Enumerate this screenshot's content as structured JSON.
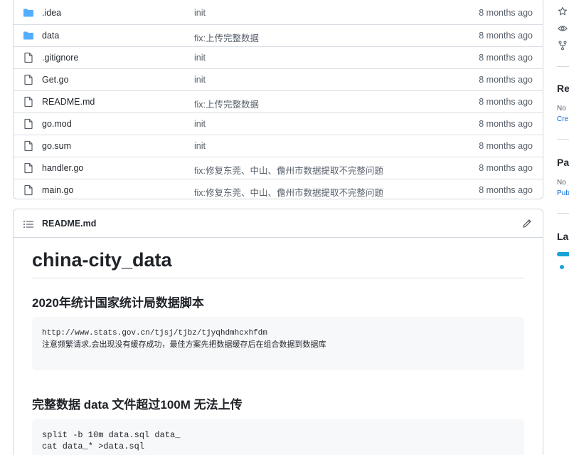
{
  "files": [
    {
      "type": "folder",
      "name": ".idea",
      "message": "init",
      "age": "8 months ago"
    },
    {
      "type": "folder",
      "name": "data",
      "message": "fix:上传完整数据",
      "age": "8 months ago"
    },
    {
      "type": "file",
      "name": ".gitignore",
      "message": "init",
      "age": "8 months ago"
    },
    {
      "type": "file",
      "name": "Get.go",
      "message": "init",
      "age": "8 months ago"
    },
    {
      "type": "file",
      "name": "README.md",
      "message": "fix:上传完整数据",
      "age": "8 months ago"
    },
    {
      "type": "file",
      "name": "go.mod",
      "message": "init",
      "age": "8 months ago"
    },
    {
      "type": "file",
      "name": "go.sum",
      "message": "init",
      "age": "8 months ago"
    },
    {
      "type": "file",
      "name": "handler.go",
      "message": "fix:修复东莞、中山、儋州市数据提取不完整问题",
      "age": "8 months ago"
    },
    {
      "type": "file",
      "name": "main.go",
      "message": "fix:修复东莞、中山、儋州市数据提取不完整问题",
      "age": "8 months ago"
    }
  ],
  "readme": {
    "title": "README.md",
    "h1": "china-city_data",
    "sections": [
      {
        "heading": "2020年统计国家统计局数据脚本",
        "code": [
          "http://www.stats.gov.cn/tjsj/tjbz/tjyqhdmhcxhfdm",
          "注意频繁请求,会出现没有缓存成功，最佳方案先把数据缓存后在组合数据到数据库"
        ]
      },
      {
        "heading": "完整数据 data 文件超过100M 无法上传",
        "code": [
          "split -b 10m data.sql data_",
          "cat data_* >data.sql"
        ]
      }
    ]
  },
  "sidebar": {
    "icons": [
      "star-icon",
      "eye-icon",
      "fork-icon"
    ],
    "releases_heading": "Re",
    "releases_text": "No",
    "releases_link": "Cre",
    "packages_heading": "Pa",
    "packages_text": "No",
    "packages_link": "Pub",
    "languages_heading": "La"
  },
  "colors": {
    "folder": "#54aeff",
    "border": "#d0d7de",
    "muted": "#57606a",
    "link": "#0969da",
    "language_go": "#18a3d6"
  }
}
